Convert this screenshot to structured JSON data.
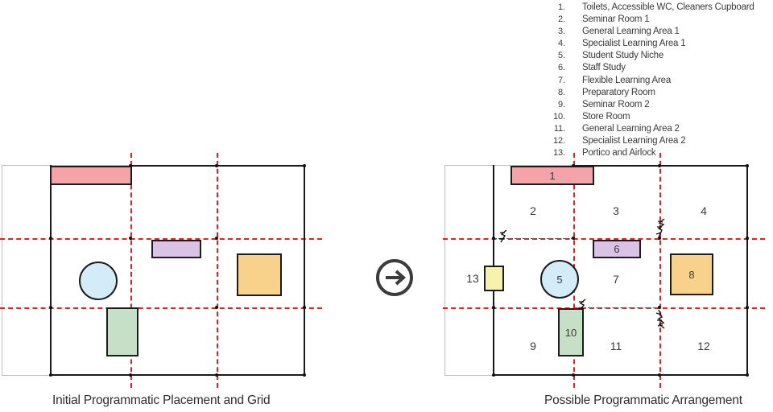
{
  "legend": {
    "items": [
      {
        "num": "1.",
        "label": "Toilets, Accessible WC, Cleaners Cupboard"
      },
      {
        "num": "2.",
        "label": "Seminar Room 1"
      },
      {
        "num": "3.",
        "label": "General Learning Area 1"
      },
      {
        "num": "4.",
        "label": "Specialist Learning Area 1"
      },
      {
        "num": "5.",
        "label": "Student Study Niche"
      },
      {
        "num": "6.",
        "label": "Staff Study"
      },
      {
        "num": "7.",
        "label": "Flexible Learning Area"
      },
      {
        "num": "8.",
        "label": "Preparatory Room"
      },
      {
        "num": "9.",
        "label": "Seminar Room 2"
      },
      {
        "num": "10.",
        "label": "Store Room"
      },
      {
        "num": "11.",
        "label": "General Learning Area 2"
      },
      {
        "num": "12.",
        "label": "Specialist Learning Area 2"
      },
      {
        "num": "13.",
        "label": "Portico and Airlock"
      }
    ]
  },
  "colors": {
    "grid_red": "#ee1c25",
    "outline_black": "#1a1a1a",
    "outer_gray": "#bdbdbd",
    "shape_pink": "#f4a3a8",
    "shape_purple": "#d9c2e4",
    "shape_blue": "#d4ecf7",
    "shape_orange": "#f8d18a",
    "shape_green": "#c6e0c8",
    "shape_yellow": "#f7f2ab"
  },
  "left_diagram": {
    "caption": "Initial Programmatic Placement and Grid",
    "shapes": [
      {
        "id": "pink-bar",
        "color": "#f4a3a8",
        "label": ""
      },
      {
        "id": "purple-bar",
        "color": "#d9c2e4",
        "label": ""
      },
      {
        "id": "blue-circle",
        "color": "#d4ecf7",
        "label": ""
      },
      {
        "id": "orange-square",
        "color": "#f8d18a",
        "label": ""
      },
      {
        "id": "green-bar",
        "color": "#c6e0c8",
        "label": ""
      }
    ]
  },
  "right_diagram": {
    "caption": "Possible Programmatic Arrangement",
    "shapes": [
      {
        "id": "pink-bar",
        "color": "#f4a3a8",
        "label": "1"
      },
      {
        "id": "purple-bar",
        "color": "#d9c2e4",
        "label": "6"
      },
      {
        "id": "blue-circle",
        "color": "#d4ecf7",
        "label": "5"
      },
      {
        "id": "orange-square",
        "color": "#f8d18a",
        "label": "8"
      },
      {
        "id": "green-bar",
        "color": "#c6e0c8",
        "label": "10"
      },
      {
        "id": "yellow-portico",
        "color": "#f7f2ab",
        "label": ""
      }
    ],
    "zone_labels": [
      {
        "id": "zone-2",
        "label": "2"
      },
      {
        "id": "zone-3",
        "label": "3"
      },
      {
        "id": "zone-4",
        "label": "4"
      },
      {
        "id": "zone-7",
        "label": "7"
      },
      {
        "id": "zone-9",
        "label": "9"
      },
      {
        "id": "zone-11",
        "label": "11"
      },
      {
        "id": "zone-12",
        "label": "12"
      },
      {
        "id": "zone-13",
        "label": "13"
      }
    ]
  },
  "arrow": {
    "icon": "circled-right-arrow"
  }
}
